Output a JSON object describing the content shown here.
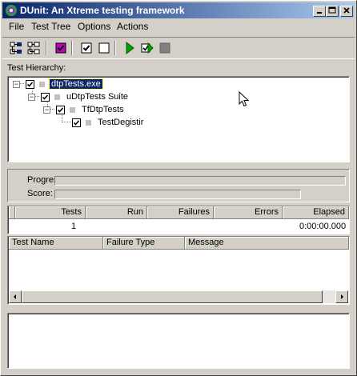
{
  "window": {
    "title": "DUnit: An Xtreme testing framework",
    "minimize": "_",
    "maximize": "□",
    "close": "×"
  },
  "menu": [
    "File",
    "Test Tree",
    "Options",
    "Actions"
  ],
  "toolbar": {
    "icons": [
      "select-all-icon",
      "deselect-all-icon",
      "select-failed-icon",
      "check-icon",
      "uncheck-icon",
      "run-icon",
      "run-selected-icon",
      "stop-icon"
    ]
  },
  "tree": {
    "label": "Test Hierarchy:",
    "items": [
      {
        "label": "dtpTests.exe",
        "level": 0,
        "checked": true,
        "expanded": true,
        "selected": true
      },
      {
        "label": "uDtpTests Suite",
        "level": 1,
        "checked": true,
        "expanded": true,
        "selected": false
      },
      {
        "label": "TfDtpTests",
        "level": 2,
        "checked": true,
        "expanded": true,
        "selected": false
      },
      {
        "label": "TestDegistir",
        "level": 3,
        "checked": true,
        "expanded": false,
        "selected": false
      }
    ]
  },
  "progress": {
    "progress_label": "Progress:",
    "score_label": "Score:",
    "progress_value": 0,
    "score_value": 0
  },
  "summary": {
    "headers": [
      "Tests",
      "Run",
      "Failures",
      "Errors",
      "Elapsed"
    ],
    "values": [
      "1",
      "",
      "",
      "",
      "0:00:00.000"
    ]
  },
  "failures": {
    "headers": [
      "Test Name",
      "Failure Type",
      "Message"
    ]
  },
  "colors": {
    "title_start": "#0a246a",
    "title_end": "#a6caf0",
    "run_green": "#00a000",
    "stop_gray": "#808080"
  }
}
